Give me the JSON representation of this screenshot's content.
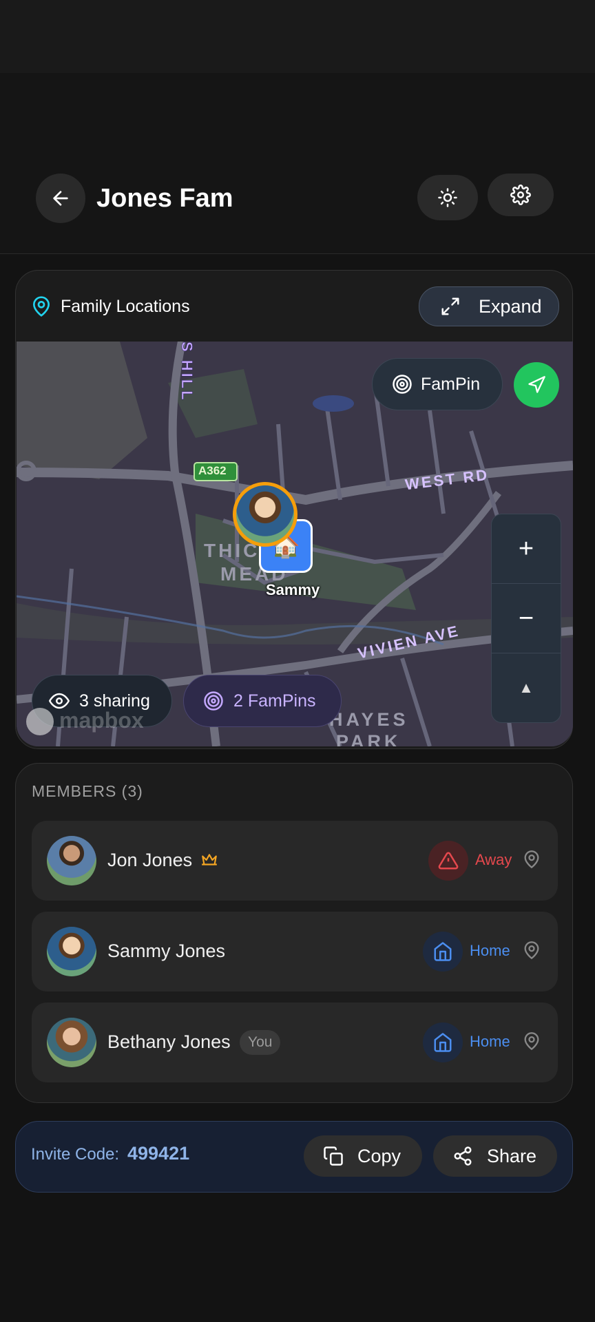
{
  "header": {
    "title": "Jones Fam"
  },
  "map_card": {
    "title": "Family Locations",
    "expand_label": "Expand",
    "fampin_label": "FamPin",
    "marker_label": "Sammy",
    "sharing_label": "3 sharing",
    "fampins_label": "2 FamPins",
    "attribution": "mapbox",
    "map_labels": {
      "road_a362": "A362",
      "west_rd": "WEST RD",
      "vivien_ave": "VIVIEN AVE",
      "s_hill": "S HILL",
      "thicket_mead_1": "THIC",
      "thicket_mead_2": "MEAD",
      "hayes_park_1": "HAYES",
      "hayes_park_2": "PARK"
    }
  },
  "members": {
    "heading": "MEMBERS (3)",
    "list": [
      {
        "name": "Jon Jones",
        "status": "Away",
        "badge": "",
        "status_color": "#e5484d"
      },
      {
        "name": "Sammy Jones",
        "status": "Home",
        "badge": "",
        "status_color": "#4b8ef0"
      },
      {
        "name": "Bethany Jones",
        "status": "Home",
        "badge": "You",
        "status_color": "#4b8ef0"
      }
    ]
  },
  "invite": {
    "label": "Invite Code:",
    "code": "499421",
    "copy_label": "Copy",
    "share_label": "Share"
  },
  "colors": {
    "accent_green": "#22c55e",
    "marker_ring": "#f59e0b",
    "home_blue": "#3b82f6",
    "away_red": "#e5484d"
  }
}
